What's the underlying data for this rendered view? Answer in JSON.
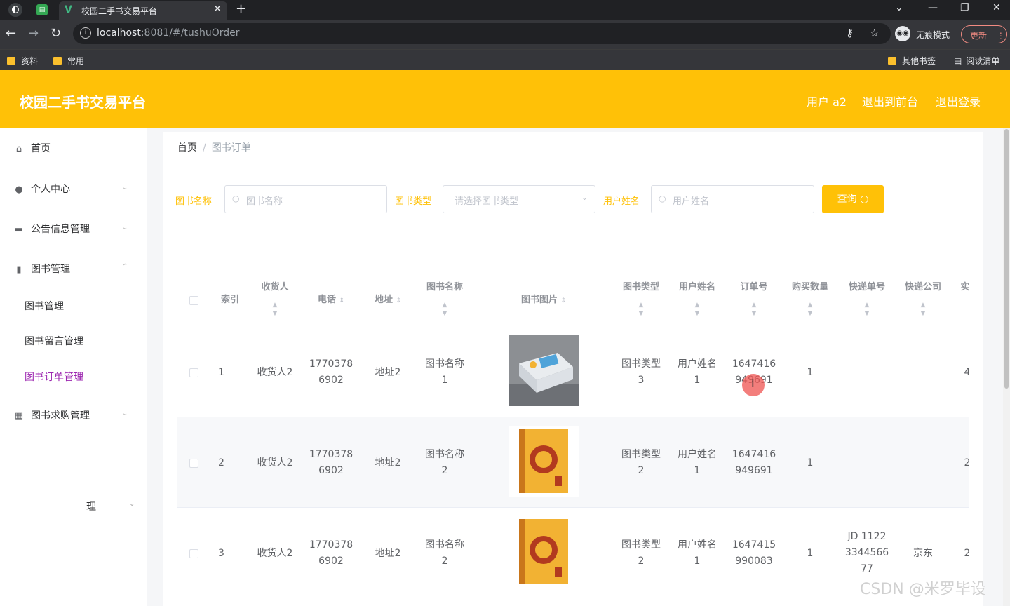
{
  "browser": {
    "tab_title": "校园二手书交易平台",
    "url_host": "localhost",
    "url_rest": ":8081/#/tushuOrder",
    "incognito_label": "无痕模式",
    "update_label": "更新",
    "bookmarks": [
      "资料",
      "常用"
    ],
    "bookmarks_right": [
      "其他书签",
      "阅读清单"
    ]
  },
  "header": {
    "brand": "校园二手书交易平台",
    "user": "用户 a2",
    "back_front": "退出到前台",
    "logout": "退出登录"
  },
  "sidebar": {
    "items": [
      {
        "label": "首页",
        "icon": "home-icon"
      },
      {
        "label": "个人中心",
        "icon": "user-icon"
      },
      {
        "label": "公告信息管理",
        "icon": "chat-icon"
      },
      {
        "label": "图书管理",
        "icon": "bar-chart-icon"
      },
      {
        "label": "图书求购管理",
        "icon": "grid-icon"
      }
    ],
    "sub_items": [
      "图书管理",
      "图书留言管理",
      "图书订单管理"
    ],
    "stray_text": "理"
  },
  "breadcrumb": {
    "home": "首页",
    "current": "图书订单"
  },
  "filters": {
    "book_name_label": "图书名称",
    "book_name_placeholder": "图书名称",
    "book_type_label": "图书类型",
    "book_type_placeholder": "请选择图书类型",
    "user_name_label": "用户姓名",
    "user_name_placeholder": "用户姓名",
    "query_label": "查询"
  },
  "table": {
    "headers": {
      "index": "索引",
      "receiver": "收货人",
      "phone": "电话",
      "address": "地址",
      "book_name": "图书名称",
      "book_image": "图书图片",
      "book_type": "图书类型",
      "user_name": "用户姓名",
      "order_no": "订单号",
      "qty": "购买数量",
      "tracking": "快递单号",
      "courier": "快递公司",
      "more": "实"
    },
    "rows": [
      {
        "index": "1",
        "receiver": "收货人2",
        "phone1": "1770378",
        "phone2": "6902",
        "address": "地址2",
        "name1": "图书名称",
        "name2": "1",
        "type1": "图书类型",
        "type2": "3",
        "user1": "用户姓名",
        "user2": "1",
        "order1": "1647416",
        "order2": "949691",
        "qty": "1",
        "track1": "",
        "track2": "",
        "track3": "",
        "courier": "",
        "more": "4"
      },
      {
        "index": "2",
        "receiver": "收货人2",
        "phone1": "1770378",
        "phone2": "6902",
        "address": "地址2",
        "name1": "图书名称",
        "name2": "2",
        "type1": "图书类型",
        "type2": "2",
        "user1": "用户姓名",
        "user2": "1",
        "order1": "1647416",
        "order2": "949691",
        "qty": "1",
        "track1": "",
        "track2": "",
        "track3": "",
        "courier": "",
        "more": "2"
      },
      {
        "index": "3",
        "receiver": "收货人2",
        "phone1": "1770378",
        "phone2": "6902",
        "address": "地址2",
        "name1": "图书名称",
        "name2": "2",
        "type1": "图书类型",
        "type2": "2",
        "user1": "用户姓名",
        "user2": "1",
        "order1": "1647415",
        "order2": "990083",
        "qty": "1",
        "track1": "JD 1122",
        "track2": "3344566",
        "track3": "77",
        "courier": "京东",
        "more": "2"
      }
    ]
  },
  "watermark": "CSDN @米罗毕设"
}
